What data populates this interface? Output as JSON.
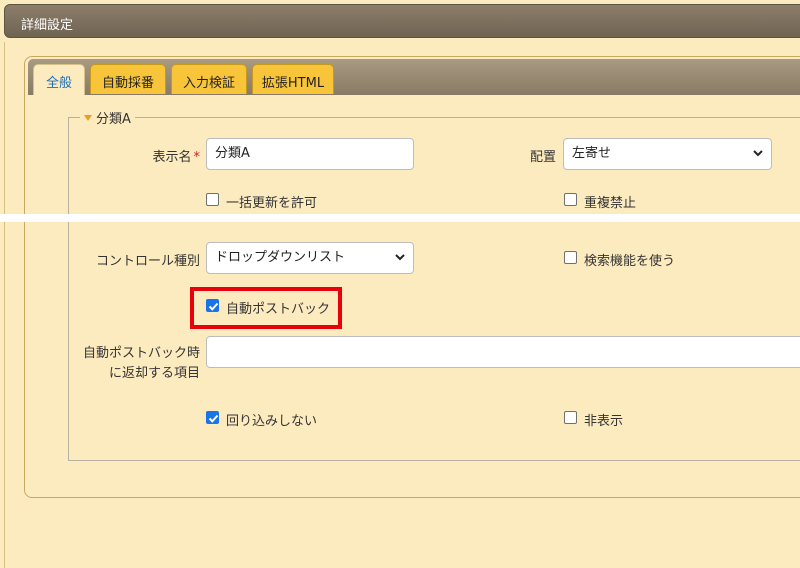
{
  "dialog": {
    "title": "詳細設定"
  },
  "tabs": [
    {
      "label": "全般",
      "active": true
    },
    {
      "label": "自動採番",
      "active": false
    },
    {
      "label": "入力検証",
      "active": false
    },
    {
      "label": "拡張HTML",
      "active": false
    }
  ],
  "section": {
    "legend": "分類A"
  },
  "fields": {
    "display_name": {
      "label": "表示名",
      "required_mark": "*",
      "value": "分類A"
    },
    "alignment": {
      "label": "配置",
      "value": "左寄せ"
    },
    "allow_bulk_update": {
      "label": "一括更新を許可",
      "checked": false
    },
    "no_duplicates": {
      "label": "重複禁止",
      "checked": false
    },
    "control_type": {
      "label": "コントロール種別",
      "value": "ドロップダウンリスト"
    },
    "use_search": {
      "label": "検索機能を使う",
      "checked": false
    },
    "auto_postback": {
      "label": "自動ポストバック",
      "checked": true
    },
    "postback_items": {
      "label_line1": "自動ポストバック時",
      "label_line2": "に返却する項目",
      "value": ""
    },
    "no_wrap": {
      "label": "回り込みしない",
      "checked": true
    },
    "hidden": {
      "label": "非表示",
      "checked": false
    }
  },
  "colors": {
    "panel_bg": "#fdebc0",
    "tab_inactive": "#f8c53a",
    "active_tab_text": "#1a6fb8",
    "highlight_border": "#e8000a",
    "checkbox_checked": "#1a73e8"
  }
}
